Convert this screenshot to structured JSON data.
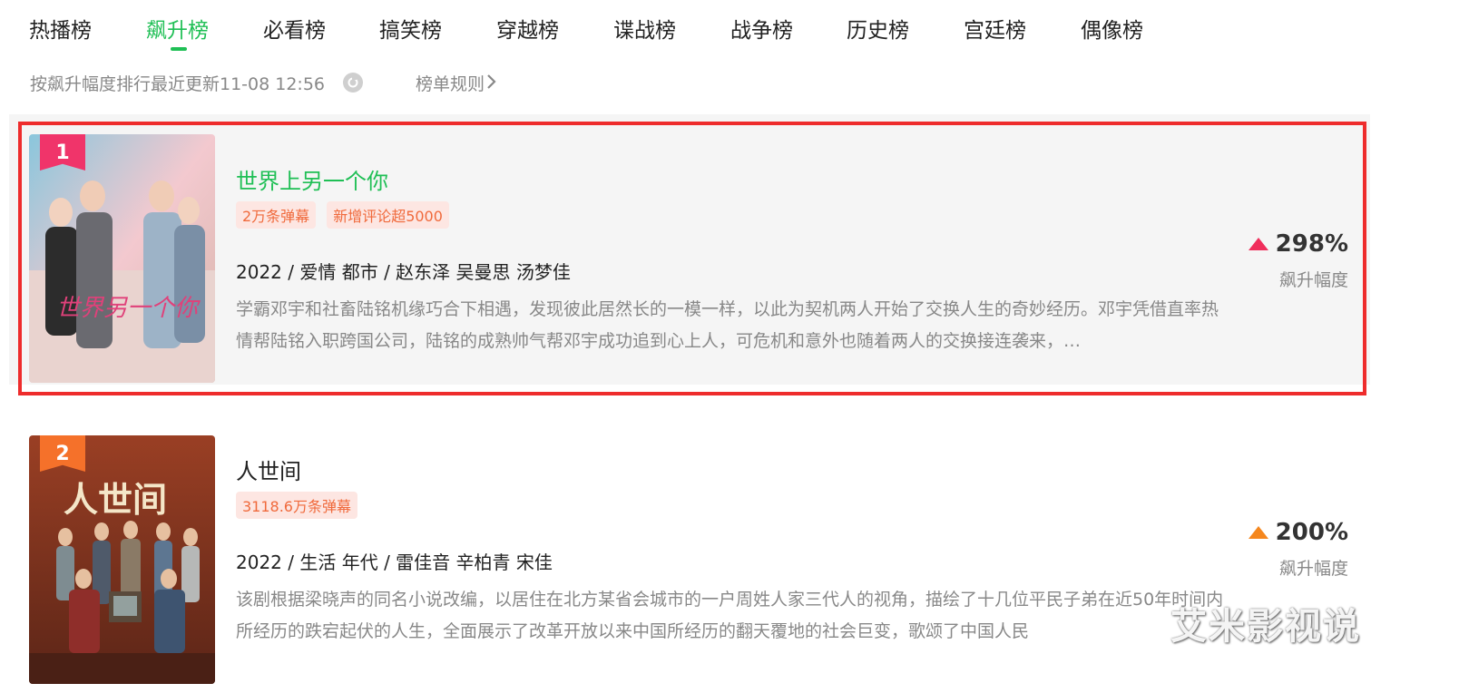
{
  "tabs": [
    {
      "label": "热播榜",
      "active": false
    },
    {
      "label": "飙升榜",
      "active": true
    },
    {
      "label": "必看榜",
      "active": false
    },
    {
      "label": "搞笑榜",
      "active": false
    },
    {
      "label": "穿越榜",
      "active": false
    },
    {
      "label": "谍战榜",
      "active": false
    },
    {
      "label": "战争榜",
      "active": false
    },
    {
      "label": "历史榜",
      "active": false
    },
    {
      "label": "宫廷榜",
      "active": false
    },
    {
      "label": "偶像榜",
      "active": false
    }
  ],
  "subbar": {
    "update_text": "按飙升幅度排行最近更新11-08 12:56",
    "rules_label": "榜单规则"
  },
  "items": [
    {
      "rank": "1",
      "title": "世界上另一个你",
      "tags": [
        "2万条弹幕",
        "新增评论超5000"
      ],
      "meta": "2022 / 爱情 都市 / 赵东泽 吴曼思 汤梦佳",
      "desc": "学霸邓宇和社畜陆铭机缘巧合下相遇，发现彼此居然长的一模一样，以此为契机两人开始了交换人生的奇妙经历。邓宇凭借直率热情帮陆铭入职跨国公司，陆铭的成熟帅气帮邓宇成功追到心上人，可危机和意外也随着两人的交换接连袭来，…",
      "rate": "298%",
      "rate_label": "飙升幅度",
      "trend_color": "#f02e5b",
      "badge_color": "#f0346a",
      "poster_art": "世界另一个你"
    },
    {
      "rank": "2",
      "title": "人世间",
      "tags": [
        "3118.6万条弹幕"
      ],
      "meta": "2022 / 生活 年代 / 雷佳音 辛柏青 宋佳",
      "desc": "该剧根据梁晓声的同名小说改编，以居住在北方某省会城市的一户周姓人家三代人的视角，描绘了十几位平民子弟在近50年时间内所经历的跌宕起伏的人生，全面展示了改革开放以来中国所经历的翻天覆地的社会巨变，歌颂了中国人民",
      "rate": "200%",
      "rate_label": "飙升幅度",
      "trend_color": "#f5871e",
      "badge_color": "#f5712a",
      "poster_art": "人世间"
    }
  ],
  "watermark": "艾米影视说",
  "colors": {
    "accent": "#1fbf55",
    "highlight_border": "#ee2c2c"
  }
}
